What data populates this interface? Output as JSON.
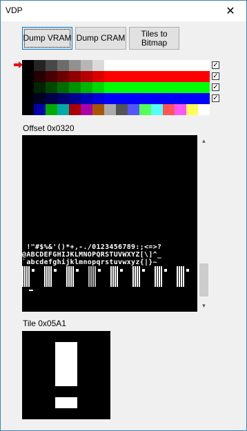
{
  "window": {
    "title": "VDP",
    "close_glyph": "✕"
  },
  "buttons": {
    "dump_vram": "Dump VRAM",
    "dump_cram": "Dump CRAM",
    "tiles_to_bitmap_line1": "Tiles to",
    "tiles_to_bitmap_line2": "Bitmap"
  },
  "palette": {
    "selected_row_indicator": "red-arrow-icon",
    "rows": [
      [
        "#000000",
        "#242424",
        "#484848",
        "#6c6c6c",
        "#919191",
        "#b6b6b6",
        "#dadada",
        "#ffffff",
        "#ffffff",
        "#ffffff",
        "#ffffff",
        "#ffffff",
        "#ffffff",
        "#ffffff",
        "#ffffff",
        "#ffffff"
      ],
      [
        "#000000",
        "#240000",
        "#480000",
        "#6c0000",
        "#910000",
        "#b60000",
        "#da0000",
        "#ff0000",
        "#ff0000",
        "#ff0000",
        "#ff0000",
        "#ff0000",
        "#ff0000",
        "#ff0000",
        "#ff0000",
        "#ff0000"
      ],
      [
        "#000000",
        "#002400",
        "#004800",
        "#006c00",
        "#009100",
        "#00b600",
        "#00da00",
        "#00ff00",
        "#00ff00",
        "#00ff00",
        "#00ff00",
        "#00ff00",
        "#00ff00",
        "#00ff00",
        "#00ff00",
        "#00ff00"
      ],
      [
        "#000000",
        "#000024",
        "#000048",
        "#00006c",
        "#000091",
        "#0000b6",
        "#0000da",
        "#0000ff",
        "#0000ff",
        "#0000ff",
        "#0000ff",
        "#0000ff",
        "#0000ff",
        "#0000ff",
        "#0000ff",
        "#0000ff"
      ],
      [
        "#000000",
        "#0000aa",
        "#00aa00",
        "#00aaaa",
        "#aa0000",
        "#aa00aa",
        "#aa5500",
        "#aaaaaa",
        "#555555",
        "#5555ff",
        "#55ff55",
        "#55ffff",
        "#ff5555",
        "#ff55ff",
        "#ffff55",
        "#ffffff"
      ]
    ],
    "checkboxes": [
      {
        "checked": true,
        "glyph": "✓"
      },
      {
        "checked": true,
        "glyph": "✓"
      },
      {
        "checked": true,
        "glyph": "✓"
      },
      {
        "checked": true,
        "glyph": "✓"
      }
    ]
  },
  "vram_view": {
    "offset_label": "Offset 0x0320",
    "line1": " !\"#$%&'()*+,-./0123456789:;<=>?",
    "line2": "@ABCDEFGHIJKLMNOPQRSTUVWXYZ[\\]^_",
    "line3": "`abcdefghijklmnopqrstuvwxyz{|}~",
    "scroll_up_icon": "▲",
    "scroll_down_icon": "▼"
  },
  "tile_view": {
    "tile_label": "Tile 0x05A1"
  }
}
